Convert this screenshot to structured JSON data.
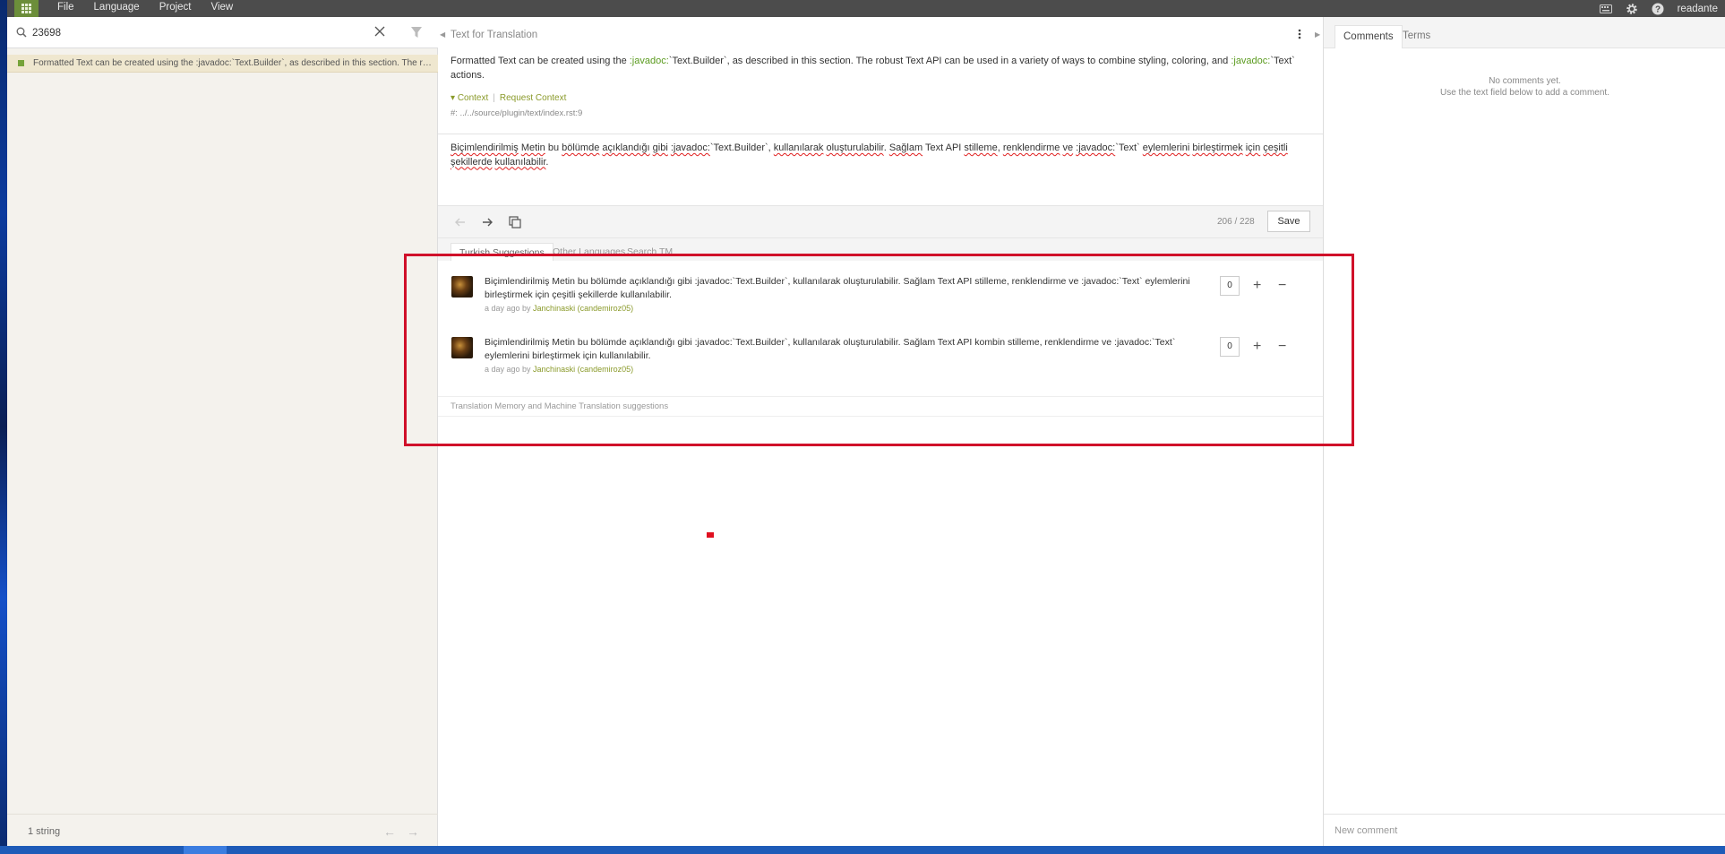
{
  "menu": {
    "items": [
      "File",
      "Language",
      "Project",
      "View"
    ]
  },
  "user": {
    "name": "readante"
  },
  "search": {
    "value": "23698"
  },
  "unit_list": {
    "items": [
      {
        "text": "Formatted Text can be created using the :javadoc:`Text.Builder`, as described in this section. The robust Text API can be used in a variety of ways to combine styling, coloring, and :javadoc:`Text` actions."
      }
    ],
    "footer_count": "1 string"
  },
  "source": {
    "title": "Text for Translation",
    "parts": [
      "Formatted Text can be created using the ",
      ":javadoc:",
      "`Text.Builder`, as described in this section. The robust Text API can be used in a variety of ways to combine styling, coloring, and ",
      ":javadoc:",
      "`Text` actions."
    ],
    "context_label": "Context",
    "context_sep": "|",
    "request_context_label": "Request Context",
    "file_path": "#: ../../source/plugin/text/index.rst:9"
  },
  "translation": {
    "words": [
      [
        "Biçimlendirilmiş",
        true
      ],
      [
        " ",
        false
      ],
      [
        "Metin",
        true
      ],
      [
        " bu ",
        false
      ],
      [
        "bölümde",
        true
      ],
      [
        " ",
        false
      ],
      [
        "açıklandığı",
        true
      ],
      [
        " ",
        false
      ],
      [
        "gibi",
        true
      ],
      [
        " ",
        false
      ],
      [
        ":javadoc:",
        true
      ],
      [
        "`Text.Builder`, ",
        false
      ],
      [
        "kullanılarak",
        true
      ],
      [
        " ",
        false
      ],
      [
        "oluşturulabilir",
        true
      ],
      [
        ". ",
        false
      ],
      [
        "Sağlam",
        true
      ],
      [
        " Text API ",
        false
      ],
      [
        "stilleme",
        true
      ],
      [
        ", ",
        false
      ],
      [
        "renklendirme",
        true
      ],
      [
        " ",
        false
      ],
      [
        "ve",
        true
      ],
      [
        " ",
        false
      ],
      [
        ":javadoc:",
        true
      ],
      [
        "`Text` ",
        false
      ],
      [
        "eylemlerini",
        true
      ],
      [
        " ",
        false
      ],
      [
        "birleştirmek",
        true
      ],
      [
        " ",
        false
      ],
      [
        "için",
        true
      ],
      [
        " ",
        false
      ],
      [
        "çeşitli",
        true
      ],
      [
        " ",
        false
      ],
      [
        "şekillerde",
        true
      ],
      [
        " ",
        false
      ],
      [
        "kullanılabilir",
        true
      ],
      [
        ".",
        false
      ]
    ]
  },
  "editor": {
    "char_count": "206 / 228",
    "save_label": "Save"
  },
  "suggestion_tabs": [
    "Turkish Suggestions",
    "Other Languages",
    "Search TM"
  ],
  "suggestions": [
    {
      "text": "Biçimlendirilmiş Metin bu bölümde açıklandığı gibi :javadoc:`Text.Builder`, kullanılarak oluşturulabilir. Sağlam Text API stilleme, renklendirme ve :javadoc:`Text` eylemlerini birleştirmek için çeşitli şekillerde kullanılabilir.",
      "meta_prefix": "a day ago by ",
      "user": "Janchinaski (candemiroz05)",
      "votes": "0"
    },
    {
      "text": "Biçimlendirilmiş Metin bu bölümde açıklandığı gibi :javadoc:`Text.Builder`, kullanılarak oluşturulabilir. Sağlam Text API kombin stilleme, renklendirme ve :javadoc:`Text` eylemlerini birleştirmek için kullanılabilir.",
      "meta_prefix": "a day ago by ",
      "user": "Janchinaski (candemiroz05)",
      "votes": "0"
    }
  ],
  "tm_section": {
    "label": "Translation Memory and Machine Translation suggestions"
  },
  "right_panel": {
    "tabs": [
      "Comments",
      "Terms"
    ],
    "no_comments_line1": "No comments yet.",
    "no_comments_line2": "Use the text field below to add a comment.",
    "new_comment_placeholder": "New comment"
  },
  "colors": {
    "accent": "#6c8e3a",
    "topbar": "#4c4c4c",
    "highlight": "#d0102a",
    "keyword": "#5a9a1e"
  },
  "icons": {
    "app": "grid-icon",
    "keyboard": "keyboard-icon",
    "settings": "gear-icon",
    "help": "help-icon",
    "search": "search-icon",
    "clear": "close-icon",
    "filter": "filter-icon",
    "menu": "vertical-dots-icon",
    "prev": "arrow-left-icon",
    "next": "arrow-right-icon",
    "copy": "copy-icon"
  }
}
